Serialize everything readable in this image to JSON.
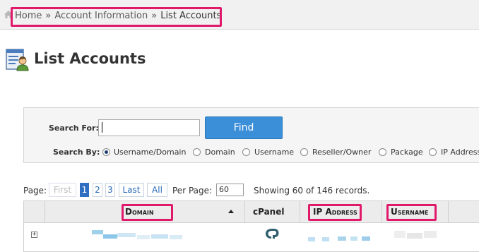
{
  "breadcrumb": {
    "home": "Home",
    "separator": "»",
    "parent": "Account Information",
    "current": "List Accounts"
  },
  "page": {
    "title": "List Accounts"
  },
  "search": {
    "label": "Search For:",
    "value": "",
    "button_label": "Find",
    "by_label": "Search By:",
    "options": [
      "Username/Domain",
      "Domain",
      "Username",
      "Reseller/Owner",
      "Package",
      "IP Address"
    ],
    "selected": "Username/Domain"
  },
  "pagination": {
    "label": "Page:",
    "first": "First",
    "pages": [
      "1",
      "2",
      "3"
    ],
    "current_page": "1",
    "last": "Last",
    "all": "All",
    "per_page_label": "Per Page:",
    "per_page_value": "60",
    "showing": "Showing 60 of 146 records."
  },
  "table": {
    "columns": {
      "domain": "Domain",
      "cpanel": "cPanel",
      "ip": "IP Address",
      "username": "Username"
    },
    "sorted_column": "domain",
    "sort_direction": "ascending"
  },
  "colors": {
    "highlight": "#e0196b",
    "find_button": "#3b8ed8",
    "active_page": "#2f6fc2"
  },
  "icons": [
    "home-icon",
    "list-accounts-icon",
    "sort-ascending-icon",
    "expand-icon",
    "cpanel-icon"
  ]
}
